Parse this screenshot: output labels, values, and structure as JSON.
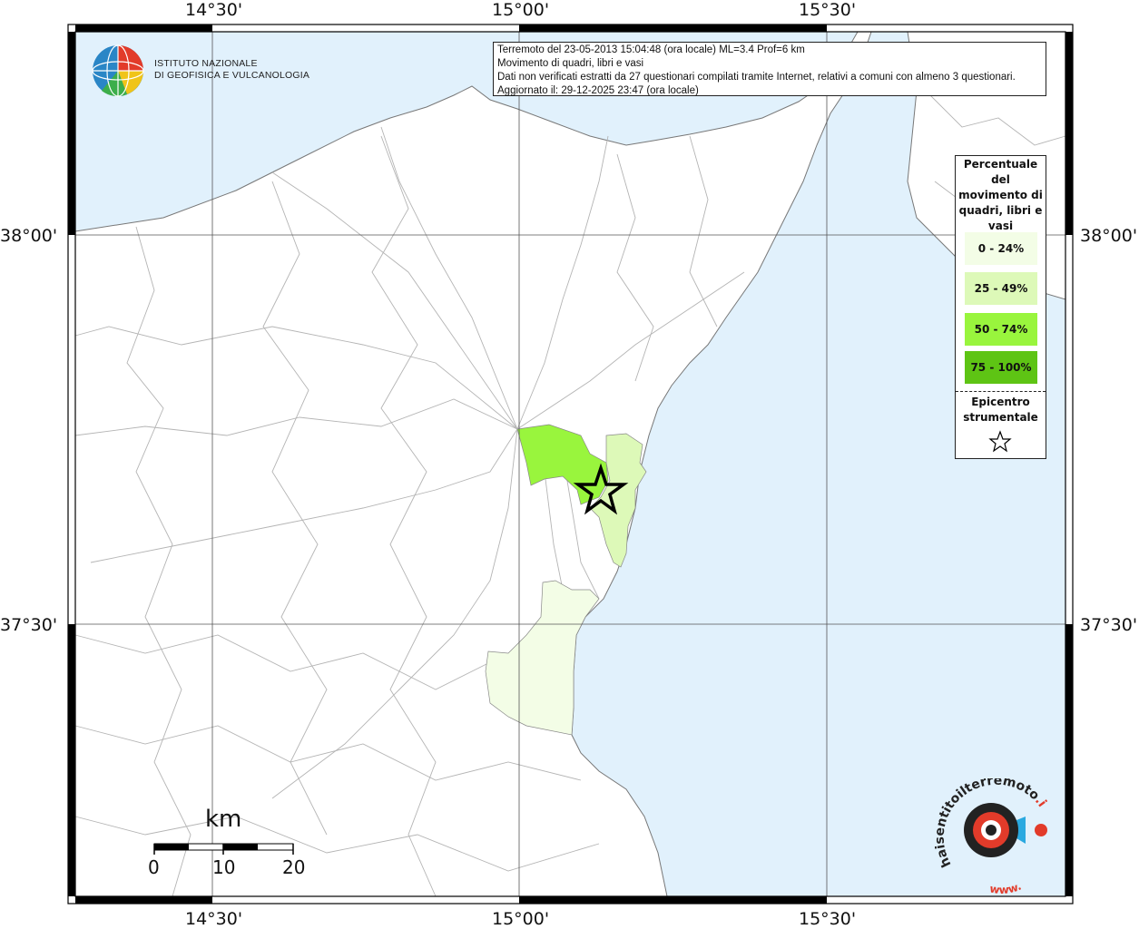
{
  "info_box": {
    "line1": "Terremoto del 23-05-2013 15:04:48 (ora locale) ML=3.4 Prof=6 km",
    "line2": "Movimento di quadri, libri e vasi",
    "line3": "Dati non verificati estratti da 27 questionari compilati tramite Internet, relativi a comuni con almeno 3 questionari.",
    "line4": "Aggiornato il: 29-12-2025 23:47 (ora locale)"
  },
  "axes": {
    "top": [
      "14°30'",
      "15°00'",
      "15°30'"
    ],
    "bottom": [
      "14°30'",
      "15°00'",
      "15°30'"
    ],
    "left": [
      "38°00'",
      "37°30'"
    ],
    "right": [
      "38°00'",
      "37°30'"
    ]
  },
  "legend": {
    "title": "Percentuale del movimento di quadri, libri e vasi",
    "items": [
      {
        "label": "0 - 24%",
        "color": "#f3fde6"
      },
      {
        "label": "25 - 49%",
        "color": "#ddf9b8"
      },
      {
        "label": "50 - 74%",
        "color": "#99f53d"
      },
      {
        "label": "75 - 100%",
        "color": "#5ec414"
      }
    ],
    "epicenter_label": "Epicentro strumentale",
    "epicenter_icon": "star-icon"
  },
  "logo_ingv": {
    "line1": "ISTITUTO NAZIONALE",
    "line2": "DI GEOFISICA E VULCANOLOGIA"
  },
  "scale_bar": {
    "unit": "km",
    "ticks": [
      "0",
      "10",
      "20"
    ]
  },
  "logo_hst": {
    "text_main": "haisentitoilterremoto",
    "text_it": ".it",
    "text_www": "www."
  },
  "colors": {
    "sea": "#e1f1fc",
    "land": "#ffffff",
    "borders": "#b4b4b4",
    "grid": "#555555"
  }
}
